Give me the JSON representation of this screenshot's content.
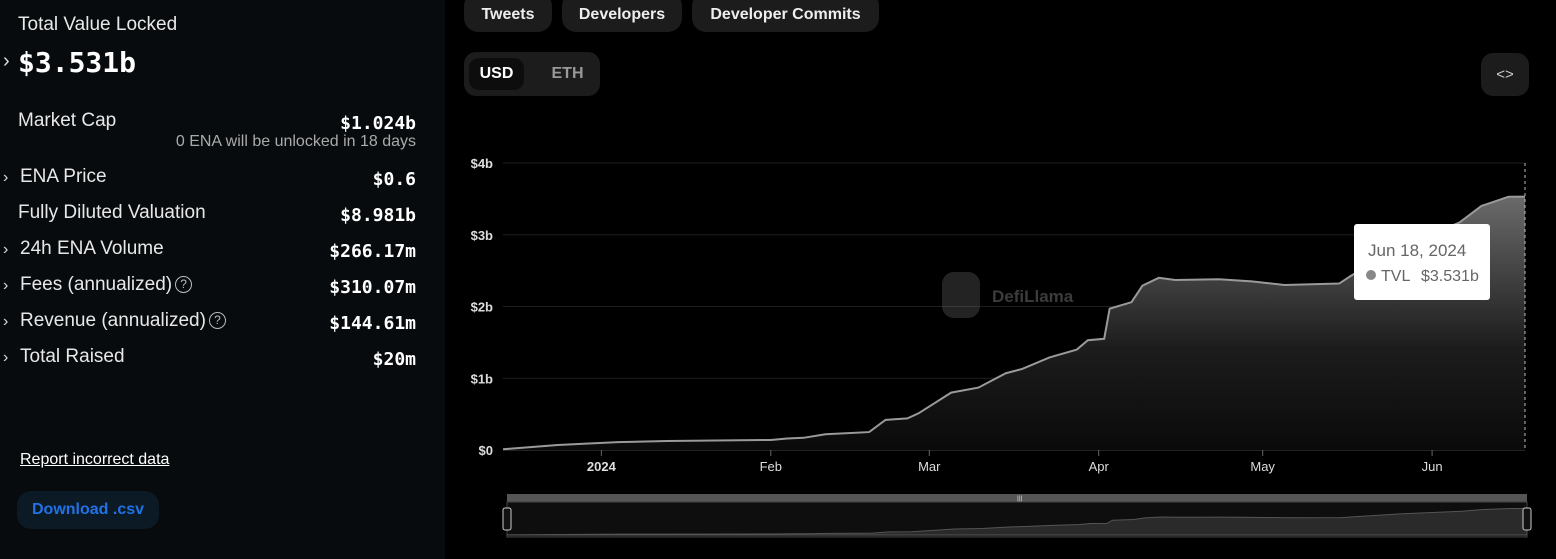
{
  "summary": {
    "tvl_label": "Total Value Locked",
    "tvl_value": "$3.531b",
    "rows": [
      {
        "label": "Market Cap",
        "value": "$1.024b",
        "sub": "0 ENA will be unlocked in 18 days",
        "expandable": false,
        "help": false
      },
      {
        "label": "ENA Price",
        "value": "$0.6",
        "expandable": true,
        "help": false
      },
      {
        "label": "Fully Diluted Valuation",
        "value": "$8.981b",
        "expandable": false,
        "help": false
      },
      {
        "label": "24h ENA Volume",
        "value": "$266.17m",
        "expandable": true,
        "help": false
      },
      {
        "label": "Fees (annualized)",
        "value": "$310.07m",
        "expandable": true,
        "help": true
      },
      {
        "label": "Revenue (annualized)",
        "value": "$144.61m",
        "expandable": true,
        "help": true
      },
      {
        "label": "Total Raised",
        "value": "$20m",
        "expandable": true,
        "help": false
      }
    ],
    "report_link": "Report incorrect data",
    "download_button": "Download .csv"
  },
  "toolbar": {
    "tabs": [
      "Tweets",
      "Developers",
      "Developer Commits"
    ],
    "currency": [
      "USD",
      "ETH"
    ],
    "selected_currency": "USD",
    "embed_icon": "<>"
  },
  "colors": {
    "download_text": "#2172e5",
    "download_bg": "#0c1a26",
    "line": "#9a9a9a"
  },
  "watermark": "DefiLlama",
  "tooltip": {
    "date": "Jun 18, 2024",
    "series": "TVL",
    "value": "$3.531b"
  },
  "chart_data": {
    "type": "area",
    "title": "",
    "xlabel": "",
    "ylabel": "TVL",
    "ylim": [
      0,
      4
    ],
    "yunit": "b USD",
    "yticks": [
      "$0",
      "$1b",
      "$2b",
      "$3b",
      "$4b"
    ],
    "xticks": [
      {
        "date": "2024-01-01",
        "label": "2024"
      },
      {
        "date": "2024-02-01",
        "label": "Feb"
      },
      {
        "date": "2024-03-01",
        "label": "Mar"
      },
      {
        "date": "2024-04-01",
        "label": "Apr"
      },
      {
        "date": "2024-05-01",
        "label": "May"
      },
      {
        "date": "2024-06-01",
        "label": "Jun"
      }
    ],
    "xrange": [
      "2023-12-14",
      "2024-06-18"
    ],
    "grid": true,
    "series": [
      {
        "name": "TVL",
        "points": [
          [
            "2023-12-14",
            0.01
          ],
          [
            "2023-12-24",
            0.07
          ],
          [
            "2024-01-04",
            0.11
          ],
          [
            "2024-01-13",
            0.125
          ],
          [
            "2024-02-01",
            0.14
          ],
          [
            "2024-02-04",
            0.16
          ],
          [
            "2024-02-07",
            0.17
          ],
          [
            "2024-02-11",
            0.22
          ],
          [
            "2024-02-19",
            0.25
          ],
          [
            "2024-02-22",
            0.42
          ],
          [
            "2024-02-26",
            0.44
          ],
          [
            "2024-02-28",
            0.51
          ],
          [
            "2024-03-05",
            0.8
          ],
          [
            "2024-03-10",
            0.87
          ],
          [
            "2024-03-15",
            1.07
          ],
          [
            "2024-03-18",
            1.13
          ],
          [
            "2024-03-23",
            1.29
          ],
          [
            "2024-03-28",
            1.4
          ],
          [
            "2024-03-30",
            1.53
          ],
          [
            "2024-04-02",
            1.55
          ],
          [
            "2024-04-03",
            1.97
          ],
          [
            "2024-04-07",
            2.06
          ],
          [
            "2024-04-09",
            2.29
          ],
          [
            "2024-04-12",
            2.4
          ],
          [
            "2024-04-15",
            2.37
          ],
          [
            "2024-04-23",
            2.38
          ],
          [
            "2024-04-29",
            2.35
          ],
          [
            "2024-05-05",
            2.3
          ],
          [
            "2024-05-15",
            2.32
          ],
          [
            "2024-05-17",
            2.42
          ],
          [
            "2024-05-25",
            2.79
          ],
          [
            "2024-06-06",
            3.17
          ],
          [
            "2024-06-10",
            3.4
          ],
          [
            "2024-06-15",
            3.53
          ],
          [
            "2024-06-18",
            3.531
          ]
        ]
      }
    ]
  }
}
